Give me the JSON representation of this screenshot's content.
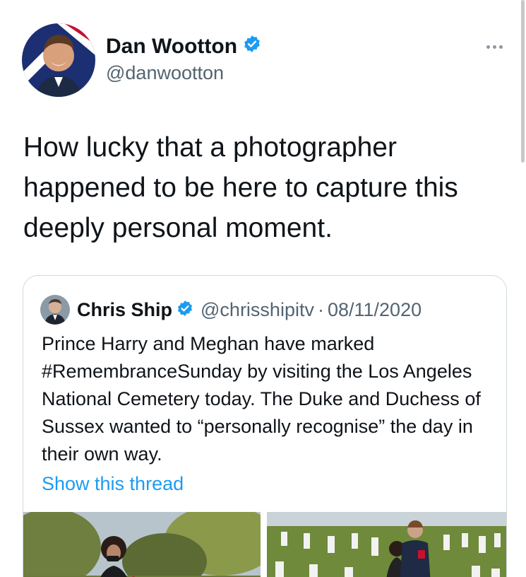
{
  "author": {
    "name": "Dan Wootton",
    "handle": "@danwootton",
    "verified": true,
    "avatar_icon": "person-avatar"
  },
  "tweet": {
    "text": "How lucky that a photographer happened to be here to capture this deeply personal moment."
  },
  "quoted_tweet": {
    "name": "Chris Ship",
    "handle": "@chrisshipitv",
    "separator": "·",
    "date": "08/11/2020",
    "verified": true,
    "text": "Prince Harry and Meghan have marked #RemembranceSunday by visiting the Los Angeles National Cemetery today. The Duke and Duchess of Sussex wanted to “personally recognise” the day in their own way.",
    "show_thread": "Show this thread"
  },
  "colors": {
    "verified_blue": "#1d9bf0",
    "link": "#1d9bf0",
    "secondary_text": "#536471"
  },
  "icons": [
    "verified-badge-icon",
    "more-options-icon"
  ]
}
